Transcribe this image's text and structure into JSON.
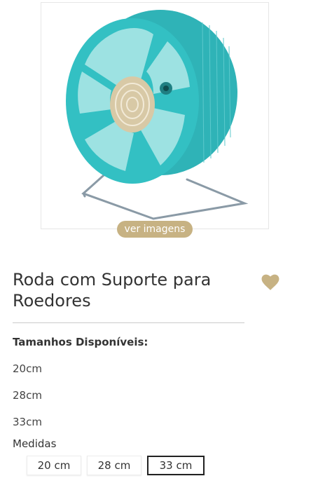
{
  "gallery": {
    "image_alt": "Roda com Suporte para Roedores",
    "ver_imagens_label": "ver imagens"
  },
  "product": {
    "title": "Roda com Suporte para Roedores",
    "favorite_icon": "heart-icon",
    "accent_color": "#c7b283"
  },
  "availability": {
    "heading": "Tamanhos Disponíveis:",
    "sizes": [
      "20cm",
      "28cm",
      "33cm"
    ]
  },
  "measures": {
    "label": "Medidas",
    "options": [
      "20 cm",
      "28 cm",
      "33 cm"
    ],
    "selected": "33 cm"
  }
}
